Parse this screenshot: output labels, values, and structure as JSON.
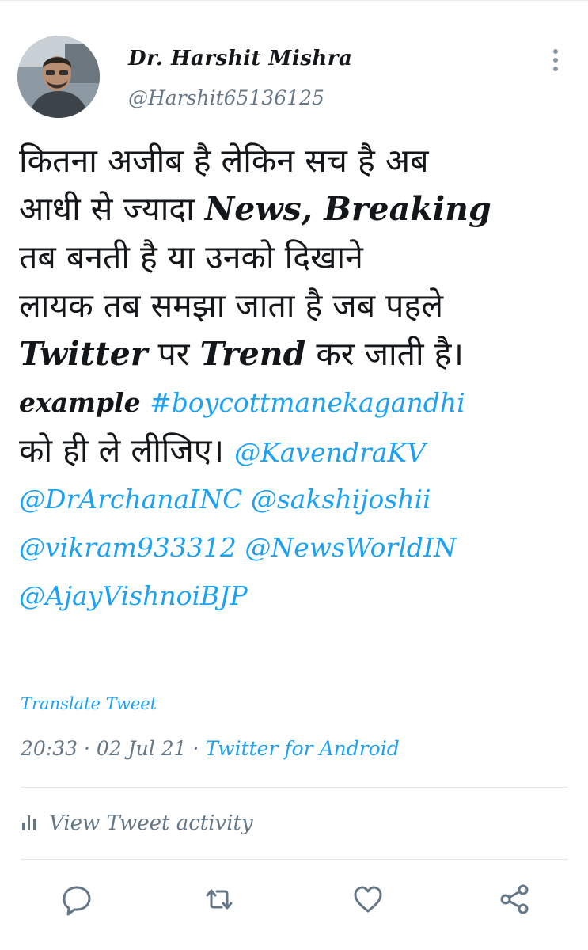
{
  "author": {
    "display_name": "Dr. Harshit Mishra",
    "handle": "@Harshit65136125"
  },
  "tweet": {
    "line1": "कितना अजीब है लेकिन सच है अब",
    "line2_a": "आधी से ज्यादा ",
    "line2_b": "News,  Breaking",
    "line3": "तब बनती है या उनको दिखाने",
    "line4": "लायक तब समझा जाता है जब पहले",
    "line5_a": "Twitter",
    "line5_b": " पर ",
    "line5_c": "Trend",
    "line5_d": " कर जाती है।",
    "line6_a": "example ",
    "hashtag": "#boycottmanekagandhi",
    "line7_a": "को ही ले लीजिए। ",
    "mentions": [
      "@KavendraKV",
      "@DrArchanaINC",
      "@sakshijoshii",
      "@vikram933312",
      "@NewsWorldIN",
      "@AjayVishnoiBJP"
    ]
  },
  "translate_label": "Translate Tweet",
  "meta": {
    "time": "20:33",
    "date": "02 Jul 21",
    "source": "Twitter for Android"
  },
  "activity_label": "View Tweet activity",
  "colors": {
    "link": "#1da1f2",
    "text": "#14171a",
    "secondary": "#657786",
    "divider": "#e1e8ed"
  },
  "icons": [
    "more-vertical-icon",
    "analytics-icon",
    "reply-icon",
    "retweet-icon",
    "like-icon",
    "share-icon"
  ]
}
